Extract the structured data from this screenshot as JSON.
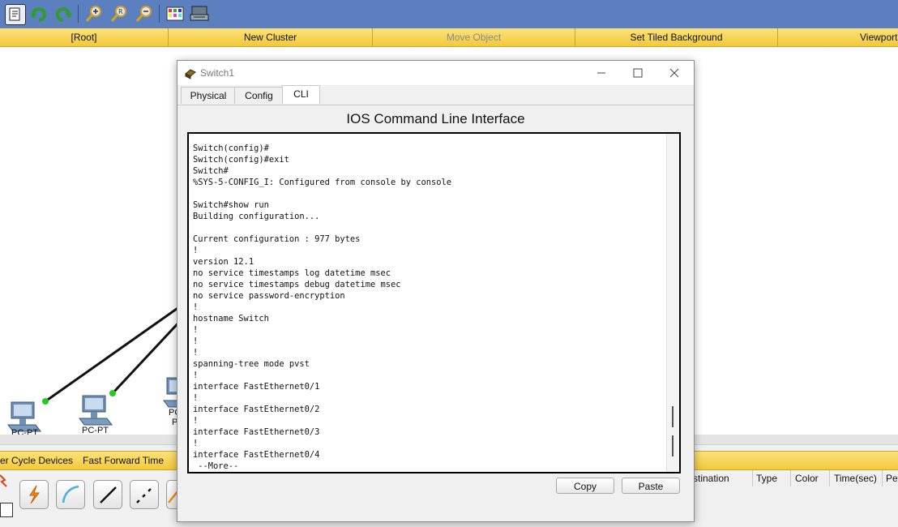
{
  "toolbar": {
    "icons": [
      "inspect-icon",
      "undo-icon",
      "redo-icon",
      "zoom-in-icon",
      "zoom-reset-icon",
      "zoom-out-icon",
      "palette-icon",
      "device-template-icon"
    ]
  },
  "logical_bar": {
    "root": "[Root]",
    "new_cluster": "New Cluster",
    "move_object": "Move Object",
    "set_tiled_background": "Set Tiled Background",
    "viewport": "Viewport"
  },
  "workspace": {
    "pc_labels": [
      "PC-PT",
      "PC-PT",
      "PC",
      "P"
    ]
  },
  "dialog": {
    "title": "Switch1",
    "tabs": [
      "Physical",
      "Config",
      "CLI"
    ],
    "active_tab": "CLI",
    "heading": "IOS Command Line Interface",
    "terminal_text": "Switch(config)#\nSwitch(config)#exit\nSwitch#\n%SYS-5-CONFIG_I: Configured from console by console\n\nSwitch#show run\nBuilding configuration...\n\nCurrent configuration : 977 bytes\n!\nversion 12.1\nno service timestamps log datetime msec\nno service timestamps debug datetime msec\nno service password-encryption\n!\nhostname Switch\n!\n!\n!\nspanning-tree mode pvst\n!\ninterface FastEthernet0/1\n!\ninterface FastEthernet0/2\n!\ninterface FastEthernet0/3\n!\ninterface FastEthernet0/4\n --More--",
    "copy_label": "Copy",
    "paste_label": "Paste"
  },
  "simulation_bar": {
    "power_cycle": "er Cycle Devices",
    "fast_forward": "Fast Forward Time"
  },
  "pdu_table": {
    "headers": [
      "stination",
      "Type",
      "Color",
      "Time(sec)",
      "Pe"
    ]
  },
  "colors": {
    "toolbar_blue": "#5b7fbf",
    "bar_yellow": "#f2c93c",
    "link_green": "#22cc22"
  }
}
